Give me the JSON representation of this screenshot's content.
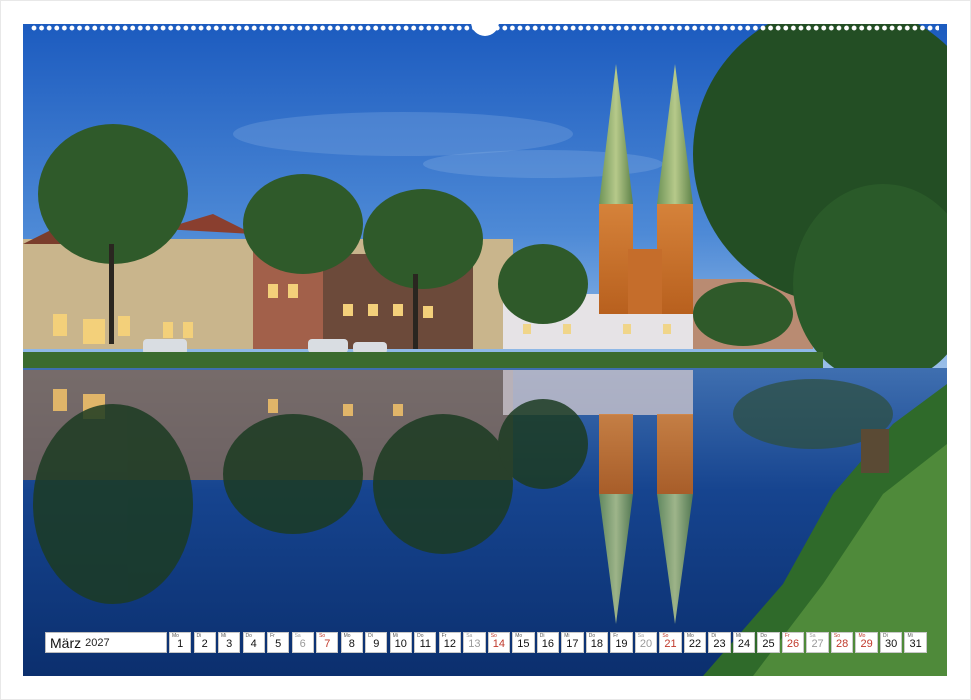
{
  "calendar": {
    "month": "März",
    "year": "2027",
    "days": [
      {
        "wd": "Mo",
        "num": "1",
        "type": "weekday"
      },
      {
        "wd": "Di",
        "num": "2",
        "type": "weekday"
      },
      {
        "wd": "Mi",
        "num": "3",
        "type": "weekday"
      },
      {
        "wd": "Do",
        "num": "4",
        "type": "weekday"
      },
      {
        "wd": "Fr",
        "num": "5",
        "type": "weekday"
      },
      {
        "wd": "Sa",
        "num": "6",
        "type": "sat"
      },
      {
        "wd": "So",
        "num": "7",
        "type": "sun"
      },
      {
        "wd": "Mo",
        "num": "8",
        "type": "weekday"
      },
      {
        "wd": "Di",
        "num": "9",
        "type": "weekday"
      },
      {
        "wd": "Mi",
        "num": "10",
        "type": "weekday"
      },
      {
        "wd": "Do",
        "num": "11",
        "type": "weekday"
      },
      {
        "wd": "Fr",
        "num": "12",
        "type": "weekday"
      },
      {
        "wd": "Sa",
        "num": "13",
        "type": "sat"
      },
      {
        "wd": "So",
        "num": "14",
        "type": "sun"
      },
      {
        "wd": "Mo",
        "num": "15",
        "type": "weekday"
      },
      {
        "wd": "Di",
        "num": "16",
        "type": "weekday"
      },
      {
        "wd": "Mi",
        "num": "17",
        "type": "weekday"
      },
      {
        "wd": "Do",
        "num": "18",
        "type": "weekday"
      },
      {
        "wd": "Fr",
        "num": "19",
        "type": "weekday"
      },
      {
        "wd": "Sa",
        "num": "20",
        "type": "sat"
      },
      {
        "wd": "So",
        "num": "21",
        "type": "sun"
      },
      {
        "wd": "Mo",
        "num": "22",
        "type": "weekday"
      },
      {
        "wd": "Di",
        "num": "23",
        "type": "weekday"
      },
      {
        "wd": "Mi",
        "num": "24",
        "type": "weekday"
      },
      {
        "wd": "Do",
        "num": "25",
        "type": "weekday"
      },
      {
        "wd": "Fr",
        "num": "26",
        "type": "sun"
      },
      {
        "wd": "Sa",
        "num": "27",
        "type": "sat"
      },
      {
        "wd": "So",
        "num": "28",
        "type": "sun"
      },
      {
        "wd": "Mo",
        "num": "29",
        "type": "sun"
      },
      {
        "wd": "Di",
        "num": "30",
        "type": "weekday"
      },
      {
        "wd": "Mi",
        "num": "31",
        "type": "weekday"
      }
    ]
  },
  "colors": {
    "sunday_red": "#c0392b",
    "saturday_gray": "#9a9a9a",
    "sky_top": "#1f63c4",
    "sky_bottom": "#8ab4e4",
    "water": "#0f3f8a",
    "tower_copper": "#c8722c",
    "spire_green": "#7fa06a"
  },
  "icons": {
    "binding": "wire-binding-icon",
    "hanger": "calendar-hanger-icon"
  }
}
